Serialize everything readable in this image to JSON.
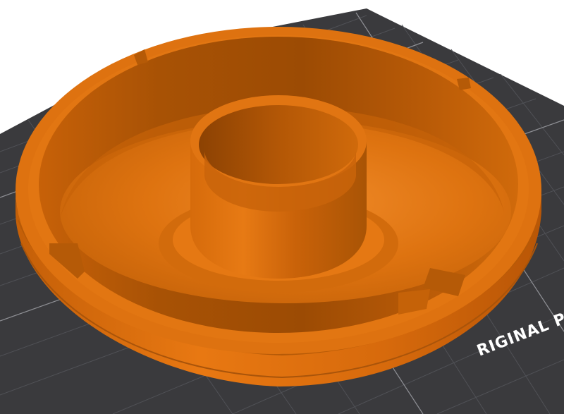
{
  "viewer": {
    "bed_label": "RIGINAL PRU"
  },
  "colors": {
    "background": "#ffffff",
    "bed_surface": "#3a3a3d",
    "bed_grid_minor": "#55565a",
    "bed_grid_major": "#8a8b8f",
    "model_base": "#e06f0c",
    "model_shadow": "#9a4a05",
    "model_highlight": "#f28a2a"
  },
  "model": {
    "name": "",
    "selected": false
  }
}
